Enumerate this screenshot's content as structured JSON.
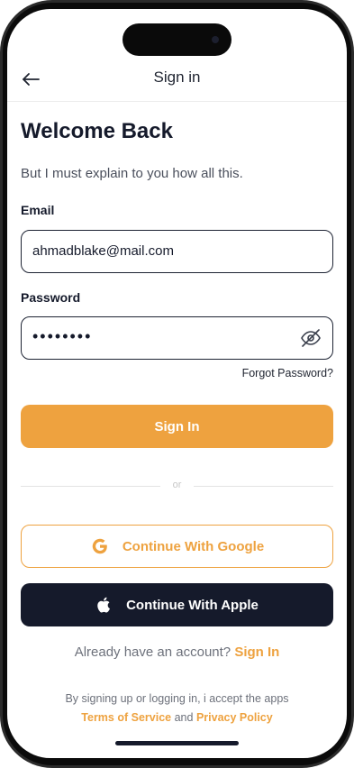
{
  "header": {
    "title": "Sign in",
    "back_icon": "arrow-left-icon"
  },
  "main": {
    "title": "Welcome Back",
    "subtitle": "But I must explain to you how all this.",
    "email": {
      "label": "Email",
      "value": "ahmadblake@mail.com"
    },
    "password": {
      "label": "Password",
      "masked_value": "••••••••",
      "toggle_icon": "eye-off-icon"
    },
    "forgot_label": "Forgot Password?",
    "sign_in_label": "Sign In",
    "divider_text": "or",
    "google_label": "Continue With Google",
    "apple_label": "Continue With Apple",
    "account_prompt": "Already have an account?",
    "account_link": "Sign In",
    "terms_prefix": "By signing up or logging in, i accept the apps",
    "terms_link": "Terms of Service",
    "terms_and": "and",
    "privacy_link": "Privacy Policy"
  },
  "colors": {
    "accent": "#eea23f",
    "dark": "#151a2b",
    "border": "#1d2333"
  }
}
